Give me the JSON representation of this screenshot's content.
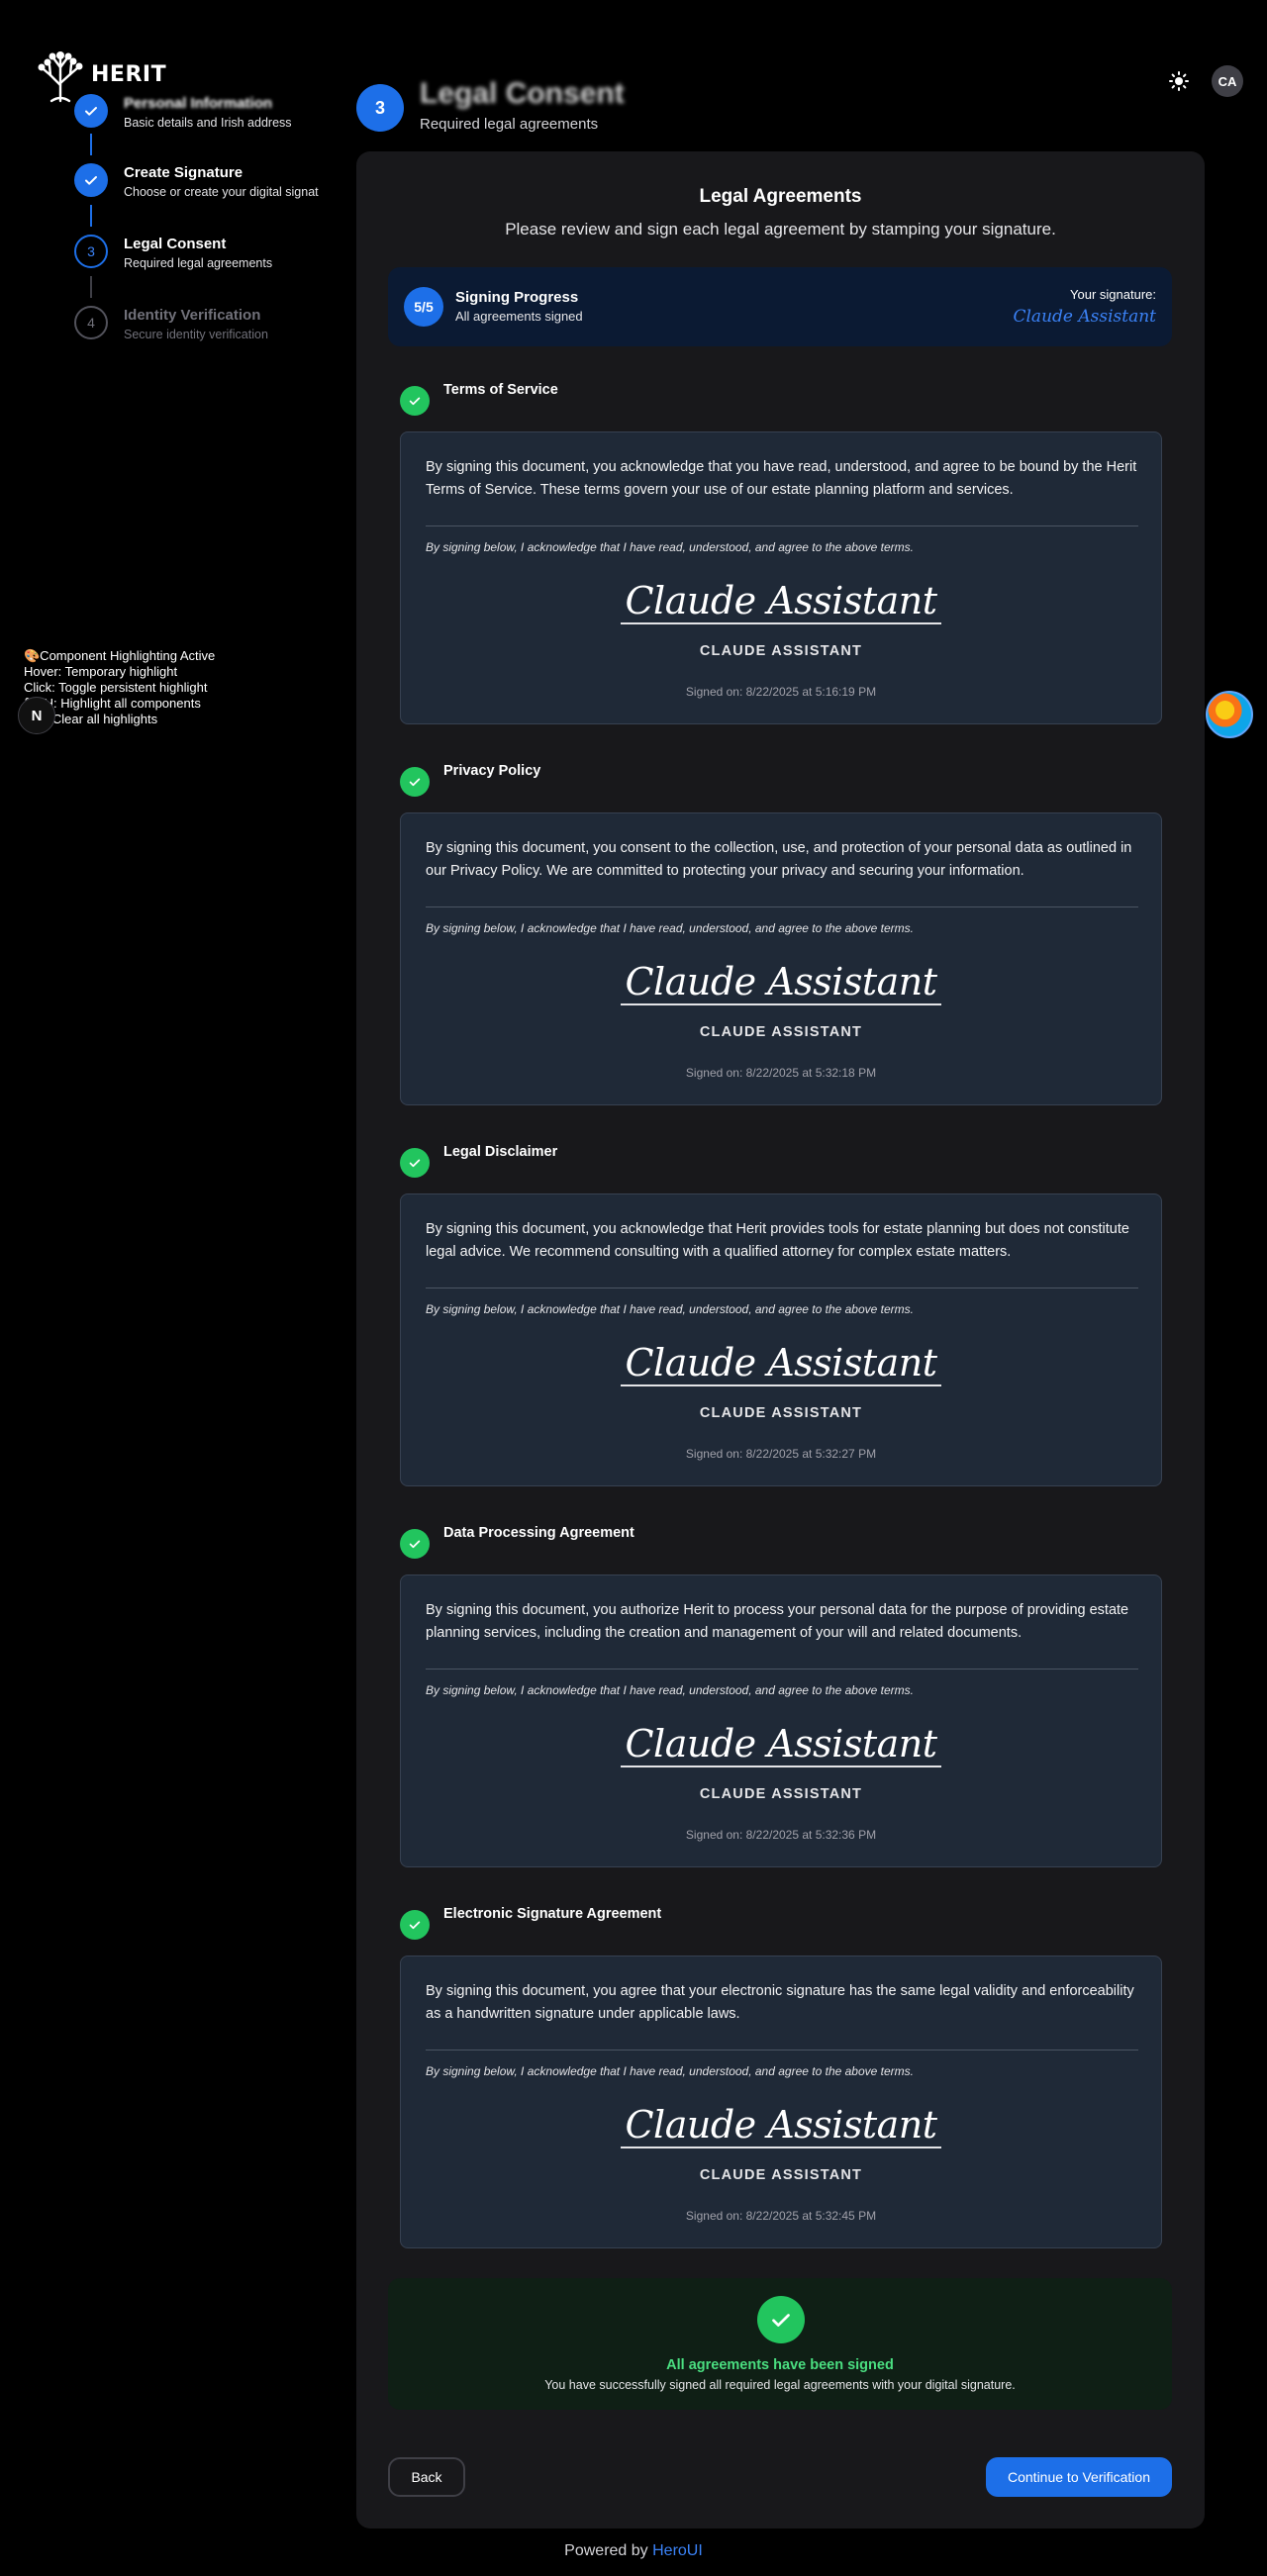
{
  "brand": {
    "name": "HERIT"
  },
  "header": {
    "avatar_initials": "CA"
  },
  "stepper": [
    {
      "number": "1",
      "title": "Personal Information",
      "description": "Basic details and Irish address",
      "state": "done"
    },
    {
      "number": "2",
      "title": "Create Signature",
      "description": "Choose or create your digital signat",
      "state": "done"
    },
    {
      "number": "3",
      "title": "Legal Consent",
      "description": "Required legal agreements",
      "state": "active"
    },
    {
      "number": "4",
      "title": "Identity Verification",
      "description": "Secure identity verification",
      "state": "pending"
    }
  ],
  "page": {
    "step_number": "3",
    "heading": "Legal Consent",
    "subheading": "Required legal agreements"
  },
  "debug_panel": {
    "line1": "🎨Component Highlighting Active",
    "line2": "Hover: Temporary highlight",
    "line3": "Click: Toggle persistent highlight",
    "line4": "⌘+H: Highlight all components",
    "line5": "Esc: Clear all highlights",
    "badge": "N"
  },
  "card": {
    "title": "Legal Agreements",
    "subtitle": "Please review and sign each legal agreement by stamping your signature."
  },
  "progress": {
    "count": "5/5",
    "title": "Signing Progress",
    "status": "All agreements signed",
    "signature_label": "Your signature:",
    "signature": "Claude Assistant"
  },
  "agreements": [
    {
      "title": "Terms of Service",
      "text": "By signing this document, you acknowledge that you have read, understood, and agree to be bound by the Herit Terms of Service. These terms govern your use of our estate planning platform and services.",
      "ack": "By signing below, I acknowledge that I have read, understood, and agree to the above terms.",
      "signature": "Claude Assistant",
      "signer": "CLAUDE ASSISTANT",
      "signed_on": "Signed on: 8/22/2025 at 5:16:19 PM"
    },
    {
      "title": "Privacy Policy",
      "text": "By signing this document, you consent to the collection, use, and protection of your personal data as outlined in our Privacy Policy. We are committed to protecting your privacy and securing your information.",
      "ack": "By signing below, I acknowledge that I have read, understood, and agree to the above terms.",
      "signature": "Claude Assistant",
      "signer": "CLAUDE ASSISTANT",
      "signed_on": "Signed on: 8/22/2025 at 5:32:18 PM"
    },
    {
      "title": "Legal Disclaimer",
      "text": "By signing this document, you acknowledge that Herit provides tools for estate planning but does not constitute legal advice. We recommend consulting with a qualified attorney for complex estate matters.",
      "ack": "By signing below, I acknowledge that I have read, understood, and agree to the above terms.",
      "signature": "Claude Assistant",
      "signer": "CLAUDE ASSISTANT",
      "signed_on": "Signed on: 8/22/2025 at 5:32:27 PM"
    },
    {
      "title": "Data Processing Agreement",
      "text": "By signing this document, you authorize Herit to process your personal data for the purpose of providing estate planning services, including the creation and management of your will and related documents.",
      "ack": "By signing below, I acknowledge that I have read, understood, and agree to the above terms.",
      "signature": "Claude Assistant",
      "signer": "CLAUDE ASSISTANT",
      "signed_on": "Signed on: 8/22/2025 at 5:32:36 PM"
    },
    {
      "title": "Electronic Signature Agreement",
      "text": "By signing this document, you agree that your electronic signature has the same legal validity and enforceability as a handwritten signature under applicable laws.",
      "ack": "By signing below, I acknowledge that I have read, understood, and agree to the above terms.",
      "signature": "Claude Assistant",
      "signer": "CLAUDE ASSISTANT",
      "signed_on": "Signed on: 8/22/2025 at 5:32:45 PM"
    }
  ],
  "success": {
    "title": "All agreements have been signed",
    "message": "You have successfully signed all required legal agreements with your digital signature."
  },
  "actions": {
    "back": "Back",
    "continue": "Continue to Verification"
  },
  "footer": {
    "prefix": "Powered by",
    "link": "HeroUI"
  },
  "colors": {
    "primary": "#1d6fe8",
    "success": "#22c55e",
    "background": "#000000",
    "card": "#18181b"
  }
}
